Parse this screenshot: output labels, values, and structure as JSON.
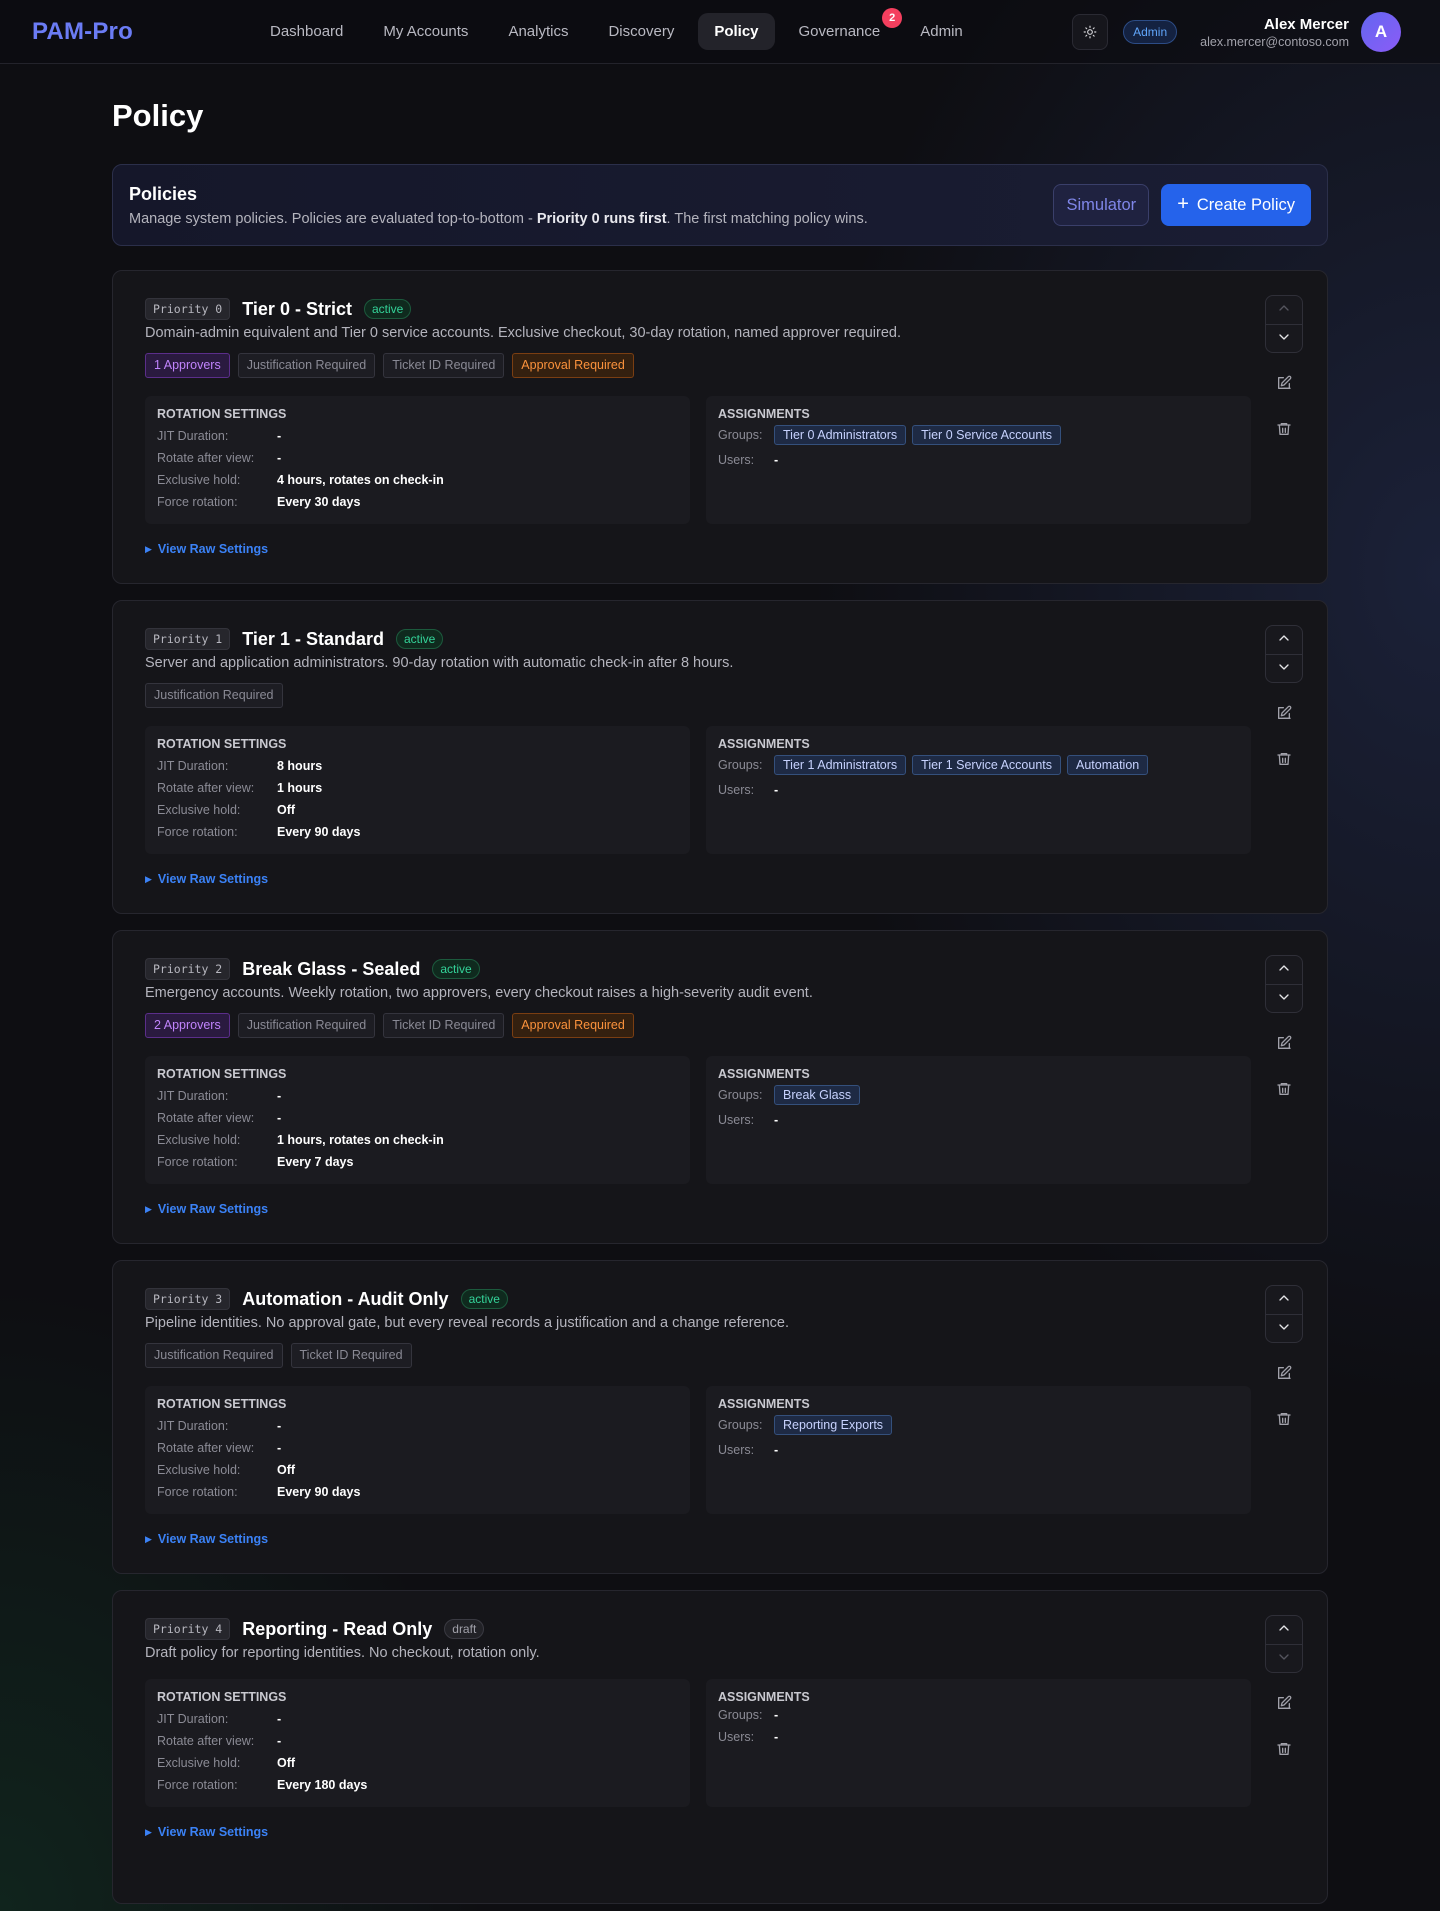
{
  "nav": {
    "logo": "PAM-Pro",
    "links": [
      "Dashboard",
      "My Accounts",
      "Analytics",
      "Discovery",
      "Policy",
      "Governance",
      "Admin"
    ],
    "active": "Policy",
    "governance_badge": "2",
    "theme_icon": "sun-icon",
    "role": "Admin",
    "user_name": "Alex Mercer",
    "user_email": "alex.mercer@contoso.com",
    "avatar_initial": "A"
  },
  "page": {
    "title": "Policy"
  },
  "intro": {
    "title": "Policies",
    "desc_pre": "Manage system policies. Policies are evaluated top-to-bottom - ",
    "desc_bold": "Priority 0 runs first",
    "desc_post": ". The first matching policy wins.",
    "simulator_label": "Simulator",
    "create_label": "Create Policy",
    "create_icon": "plus-icon"
  },
  "labels": {
    "rotation_title": "ROTATION SETTINGS",
    "assignments_title": "ASSIGNMENTS",
    "jit": "JIT Duration:",
    "rotate_after_view": "Rotate after view:",
    "exclusive_hold": "Exclusive hold:",
    "force_rotation": "Force rotation:",
    "groups": "Groups:",
    "users": "Users:",
    "view_raw": "View Raw Settings"
  },
  "policies": [
    {
      "priority": "Priority 0",
      "name": "Tier 0 - Strict",
      "status": "active",
      "desc": "Domain-admin equivalent and Tier 0 service accounts. Exclusive checkout, 30-day rotation, named approver required.",
      "tags": [
        [
          "1 Approvers",
          "purple"
        ],
        [
          "Justification Required",
          "gray"
        ],
        [
          "Ticket ID Required",
          "gray"
        ],
        [
          "Approval Required",
          "orange"
        ]
      ],
      "jit": "-",
      "rotate_after_view": "-",
      "exclusive_hold": "4 hours, rotates on check-in",
      "force_rotation": "Every 30 days",
      "groups": [
        "Tier 0 Administrators",
        "Tier 0 Service Accounts"
      ],
      "users": "-",
      "up_enabled": false,
      "down_enabled": true
    },
    {
      "priority": "Priority 1",
      "name": "Tier 1 - Standard",
      "status": "active",
      "desc": "Server and application administrators. 90-day rotation with automatic check-in after 8 hours.",
      "tags": [
        [
          "Justification Required",
          "gray"
        ]
      ],
      "jit": "8 hours",
      "rotate_after_view": "1 hours",
      "exclusive_hold": "Off",
      "force_rotation": "Every 90 days",
      "groups": [
        "Tier 1 Administrators",
        "Tier 1 Service Accounts",
        "Automation"
      ],
      "users": "-",
      "up_enabled": true,
      "down_enabled": true
    },
    {
      "priority": "Priority 2",
      "name": "Break Glass - Sealed",
      "status": "active",
      "desc": "Emergency accounts. Weekly rotation, two approvers, every checkout raises a high-severity audit event.",
      "tags": [
        [
          "2 Approvers",
          "purple"
        ],
        [
          "Justification Required",
          "gray"
        ],
        [
          "Ticket ID Required",
          "gray"
        ],
        [
          "Approval Required",
          "orange"
        ]
      ],
      "jit": "-",
      "rotate_after_view": "-",
      "exclusive_hold": "1 hours, rotates on check-in",
      "force_rotation": "Every 7 days",
      "groups": [
        "Break Glass"
      ],
      "users": "-",
      "up_enabled": true,
      "down_enabled": true
    },
    {
      "priority": "Priority 3",
      "name": "Automation - Audit Only",
      "status": "active",
      "desc": "Pipeline identities. No approval gate, but every reveal records a justification and a change reference.",
      "tags": [
        [
          "Justification Required",
          "gray"
        ],
        [
          "Ticket ID Required",
          "gray"
        ]
      ],
      "jit": "-",
      "rotate_after_view": "-",
      "exclusive_hold": "Off",
      "force_rotation": "Every 90 days",
      "groups": [
        "Reporting Exports"
      ],
      "users": "-",
      "up_enabled": true,
      "down_enabled": true
    },
    {
      "priority": "Priority 4",
      "name": "Reporting - Read Only",
      "status": "draft",
      "desc": "Draft policy for reporting identities. No checkout, rotation only.",
      "tags": [],
      "jit": "-",
      "rotate_after_view": "-",
      "exclusive_hold": "Off",
      "force_rotation": "Every 180 days",
      "groups": [],
      "groups_empty": "-",
      "users": "-",
      "up_enabled": true,
      "down_enabled": false
    }
  ],
  "icons": {
    "up": "chevron-up-icon",
    "down": "chevron-down-icon",
    "edit": "edit-icon",
    "delete": "trash-icon",
    "expand": "triangle-right-icon"
  },
  "colors": {
    "accent": "#2563eb",
    "logo": "#6b7cf5",
    "active_status": "#34d399",
    "badge": "#f43f5e"
  }
}
